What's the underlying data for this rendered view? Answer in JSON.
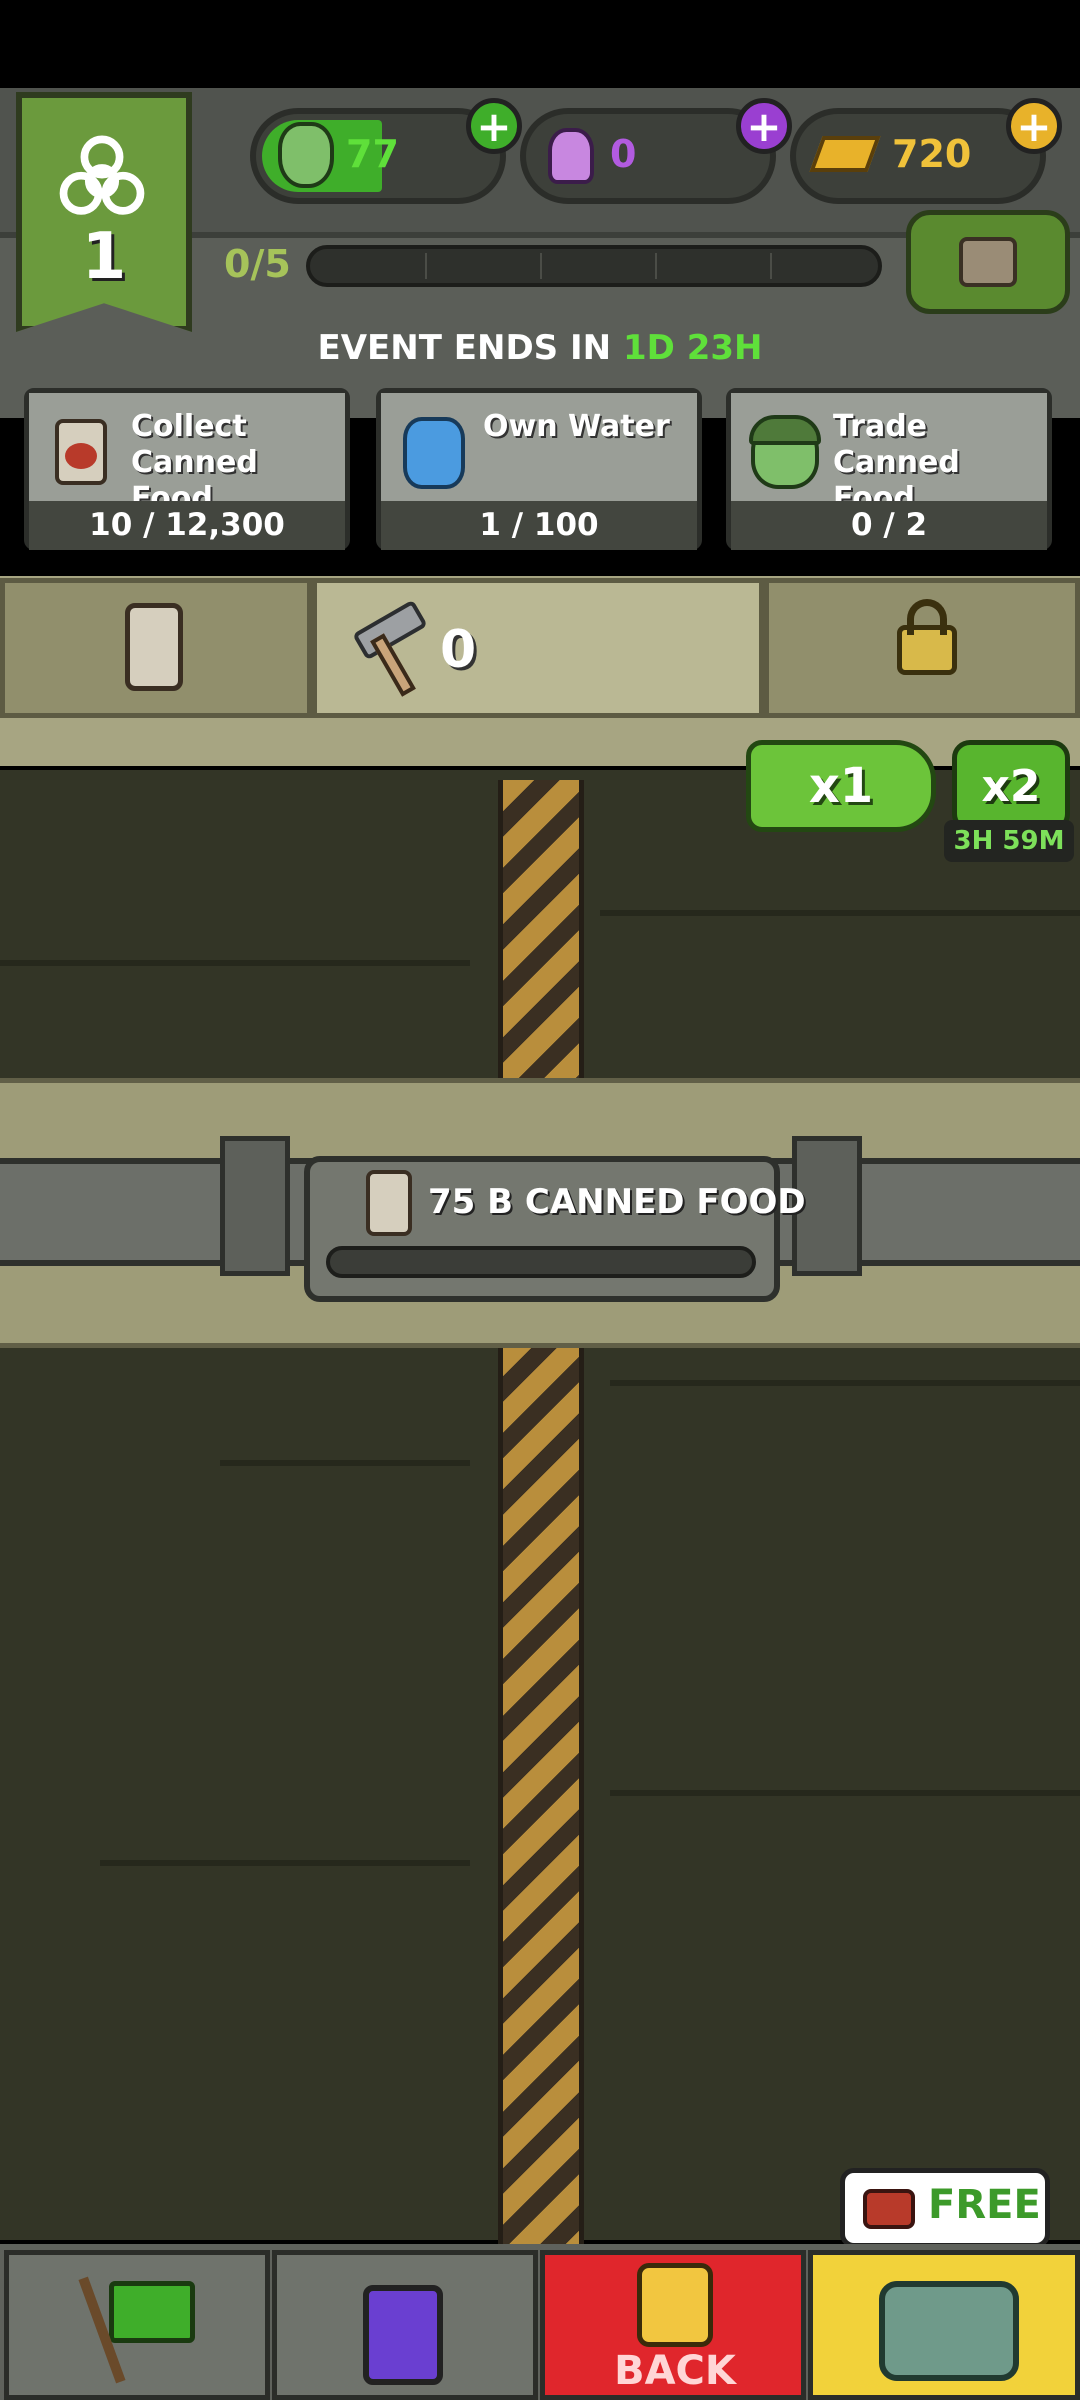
{
  "header": {
    "level": "1",
    "currencies": [
      {
        "name": "zombies",
        "value": "77",
        "icon": "zombie-head-icon",
        "accent": "#3fae2a"
      },
      {
        "name": "potion",
        "value": "0",
        "icon": "potion-icon",
        "accent": "#9a3fd1"
      },
      {
        "name": "gold",
        "value": "720",
        "icon": "gold-bars-icon",
        "accent": "#e8b22a"
      }
    ],
    "progress_label": "0/5",
    "progress_value": 0,
    "event_prefix": "EVENT ENDS IN",
    "event_days": "1D",
    "event_hours": "23H"
  },
  "tasks": [
    {
      "title": "Collect Canned Food",
      "progress": "10 / 12,300",
      "icon": "canned-food-icon"
    },
    {
      "title": "Own Water",
      "progress": "1 / 100",
      "icon": "water-jug-icon"
    },
    {
      "title": "Trade Canned Food",
      "progress": "0 / 2",
      "icon": "soldier-zombie-icon"
    }
  ],
  "tabs": {
    "hammer_count": "0"
  },
  "boost": {
    "x1_label": "x1",
    "x2_label": "x2",
    "x2_timer": "3H 59M"
  },
  "collect": {
    "label": "75 B CANNED FOOD"
  },
  "nav": {
    "back_label": "BACK",
    "free_label": "FREE"
  },
  "colors": {
    "green_text": "#5fe03a",
    "shaft": "#333526"
  }
}
